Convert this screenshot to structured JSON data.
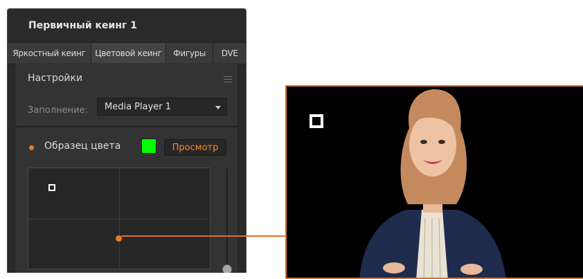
{
  "panel": {
    "title": "Первичный кеинг 1",
    "tabs": [
      {
        "label": "Яркостный кеинг"
      },
      {
        "label": "Цветовой кеинг"
      },
      {
        "label": "Фигуры"
      },
      {
        "label": "DVE"
      }
    ],
    "settings": {
      "title": "Настройки",
      "fill_label": "Заполнение:",
      "fill_value": "Media Player 1"
    },
    "sample": {
      "label": "Образец цвета",
      "swatch_color": "#00ff00",
      "preview_label": "Просмотр"
    }
  },
  "icons": {
    "menu": "hamburger-menu-icon",
    "dropdown": "chevron-down-icon"
  },
  "colors": {
    "accent": "#f07822",
    "panel_bg": "#2a2a2a",
    "swatch": "#00ff00"
  }
}
